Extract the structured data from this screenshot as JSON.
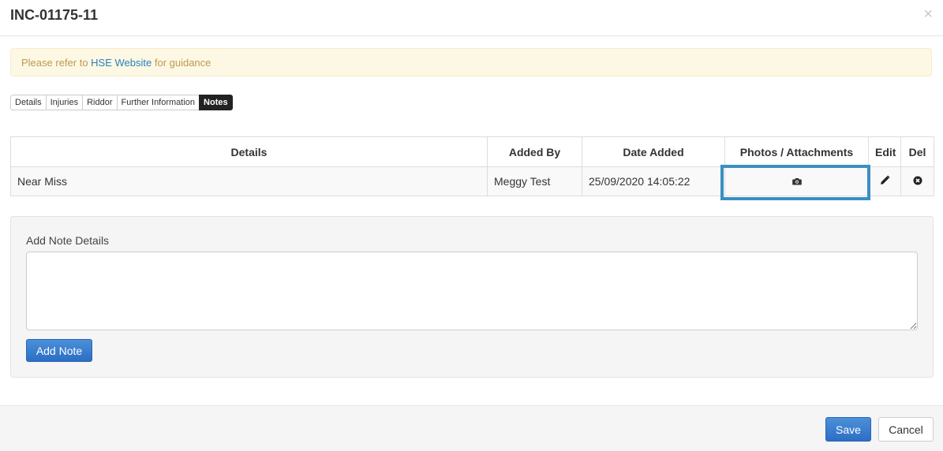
{
  "modal": {
    "title": "INC-01175-11",
    "close": "×"
  },
  "alert": {
    "prefix": "Please refer to ",
    "link": "HSE Website",
    "suffix": " for guidance"
  },
  "tabs": [
    {
      "label": "Details"
    },
    {
      "label": "Injuries"
    },
    {
      "label": "Riddor"
    },
    {
      "label": "Further Information"
    },
    {
      "label": "Notes",
      "active": true
    }
  ],
  "table": {
    "headers": [
      "Details",
      "Added By",
      "Date Added",
      "Photos / Attachments",
      "Edit",
      "Del"
    ],
    "rows": [
      {
        "details": "Near Miss",
        "added_by": "Meggy Test",
        "date_added": "25/09/2020 14:05:22"
      }
    ]
  },
  "add_note": {
    "label": "Add Note Details",
    "placeholder": "",
    "button": "Add Note"
  },
  "footer": {
    "save": "Save",
    "cancel": "Cancel"
  },
  "colors": {
    "primary": "#2c6ec4",
    "highlight": "#3a8fc1",
    "alert_bg": "#fcf8e3",
    "alert_text": "#c09853",
    "link": "#2a7fc0"
  },
  "icons": {
    "photos": "camera-icon",
    "edit": "pencil-icon",
    "delete": "times-circle-icon"
  }
}
